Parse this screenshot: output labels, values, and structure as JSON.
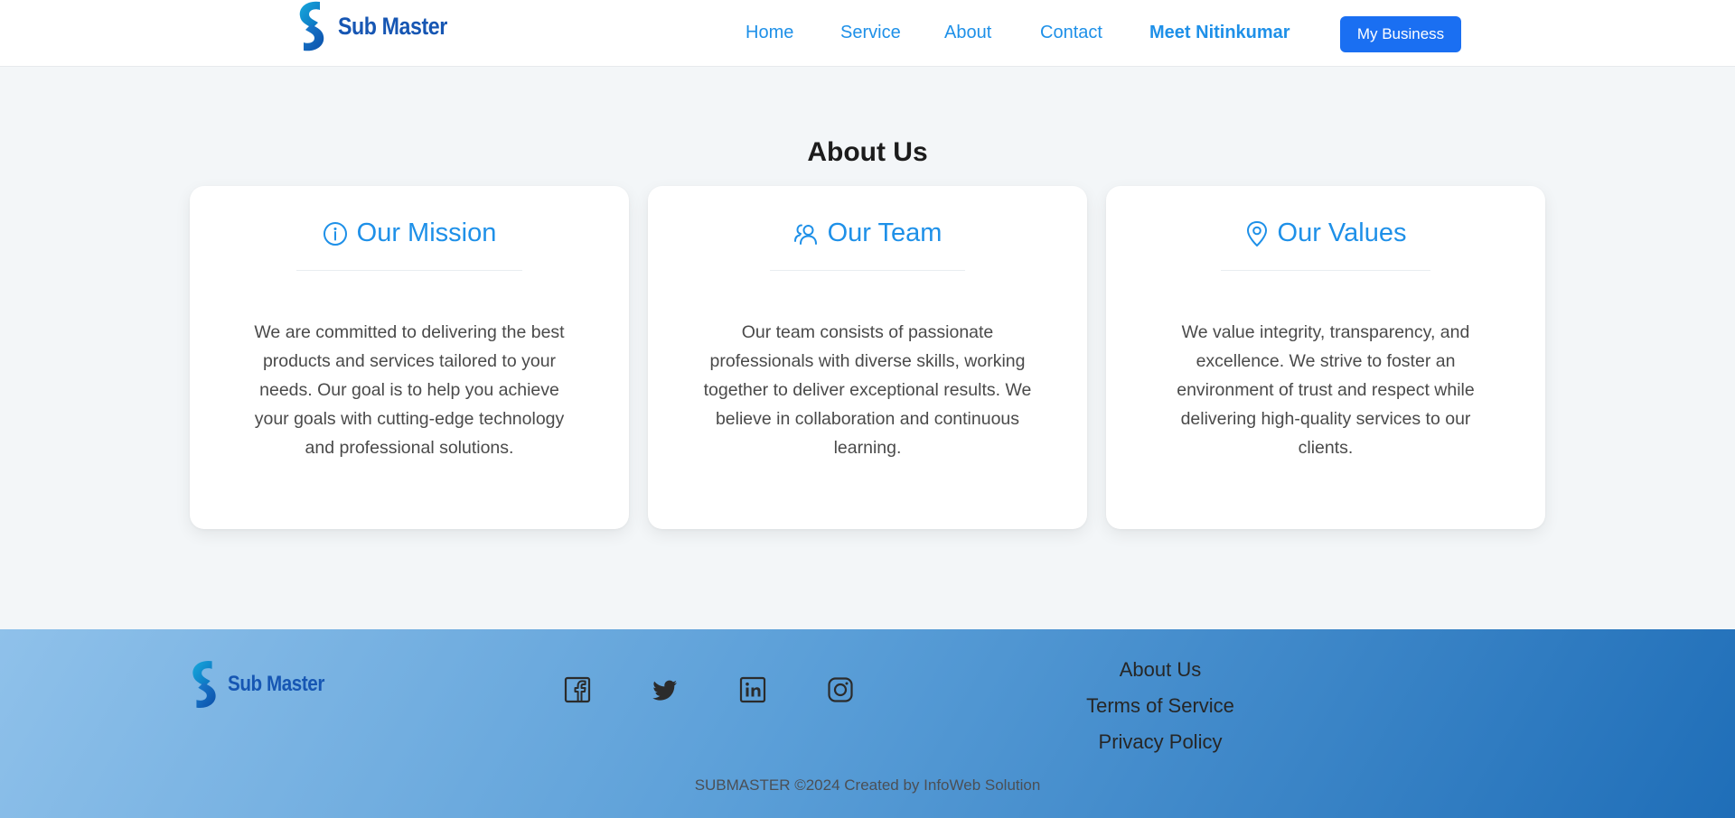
{
  "header": {
    "logo_text": "Sub Master",
    "nav": {
      "home": "Home",
      "service": "Service",
      "about": "About",
      "contact": "Contact",
      "meet": "Meet Nitinkumar"
    },
    "cta_label": "My Business"
  },
  "main": {
    "title": "About Us",
    "cards": [
      {
        "icon": "info-icon",
        "title": "Our Mission",
        "text": "We are committed to delivering the best products and services tailored to your needs. Our goal is to help you achieve your goals with cutting-edge technology and professional solutions."
      },
      {
        "icon": "team-icon",
        "title": "Our Team",
        "text": "Our team consists of passionate professionals with diverse skills, working together to deliver exceptional results. We believe in collaboration and continuous learning."
      },
      {
        "icon": "location-pin-icon",
        "title": "Our Values",
        "text": "We value integrity, transparency, and excellence. We strive to foster an environment of trust and respect while delivering high-quality services to our clients."
      }
    ]
  },
  "footer": {
    "logo_text": "Sub Master",
    "social_icons": [
      "facebook-icon",
      "twitter-icon",
      "linkedin-icon",
      "instagram-icon"
    ],
    "links": {
      "about": "About Us",
      "terms": "Terms of Service",
      "privacy": "Privacy Policy"
    },
    "copyright": "SUBMASTER ©2024 Created by InfoWeb Solution"
  },
  "colors": {
    "accent": "#1e90e8",
    "brand": "#1656b3",
    "button": "#1a6ff2",
    "background": "#f3f6f8"
  }
}
